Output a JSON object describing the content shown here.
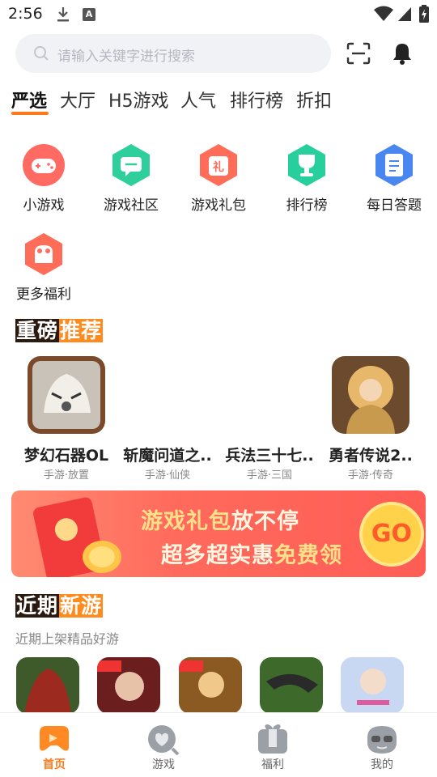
{
  "status_bar": {
    "time": "2:56",
    "icons": [
      "download-icon",
      "a-icon",
      "wifi-icon",
      "signal-icon",
      "battery-icon"
    ]
  },
  "header": {
    "search_placeholder": "请输入关键字进行搜索",
    "icons": [
      "search-icon",
      "scan-icon",
      "bell-icon"
    ]
  },
  "tabs": [
    {
      "label": "严选",
      "active": true
    },
    {
      "label": "大厅"
    },
    {
      "label": "H5游戏"
    },
    {
      "label": "人气"
    },
    {
      "label": "排行榜"
    },
    {
      "label": "折扣"
    }
  ],
  "quick_entries": [
    {
      "label": "小游戏",
      "icon": "gamepad-icon"
    },
    {
      "label": "游戏社区",
      "icon": "chat-icon"
    },
    {
      "label": "游戏礼包",
      "icon": "gift-icon"
    },
    {
      "label": "排行榜",
      "icon": "trophy-icon"
    },
    {
      "label": "每日答题",
      "icon": "quiz-icon"
    },
    {
      "label": "更多福利",
      "icon": "cake-icon"
    }
  ],
  "featured": {
    "title_dark": "重磅",
    "title_orange": "推荐",
    "games": [
      {
        "name": "梦幻石器OL",
        "tag": "手游·放置"
      },
      {
        "name": "斩魔问道之..",
        "tag": "手游·仙侠"
      },
      {
        "name": "兵法三十七..",
        "tag": "手游·三国"
      },
      {
        "name": "勇者传说2..",
        "tag": "手游·传奇"
      }
    ]
  },
  "banner": {
    "line1_a": "游戏礼包",
    "line1_b": "放不停",
    "line2_a": "超多超实惠",
    "line2_b": "免费领",
    "go": "GO"
  },
  "new_games": {
    "title_dark": "近期",
    "title_orange": "新游",
    "subtitle": "近期上架精品好游"
  },
  "bottom_nav": [
    {
      "label": "首页",
      "active": true
    },
    {
      "label": "游戏"
    },
    {
      "label": "福利"
    },
    {
      "label": "我的"
    }
  ],
  "colors": {
    "accent": "#ff7a1a",
    "banner": "#ff6a5c",
    "section_dark": "#2a1a10"
  }
}
